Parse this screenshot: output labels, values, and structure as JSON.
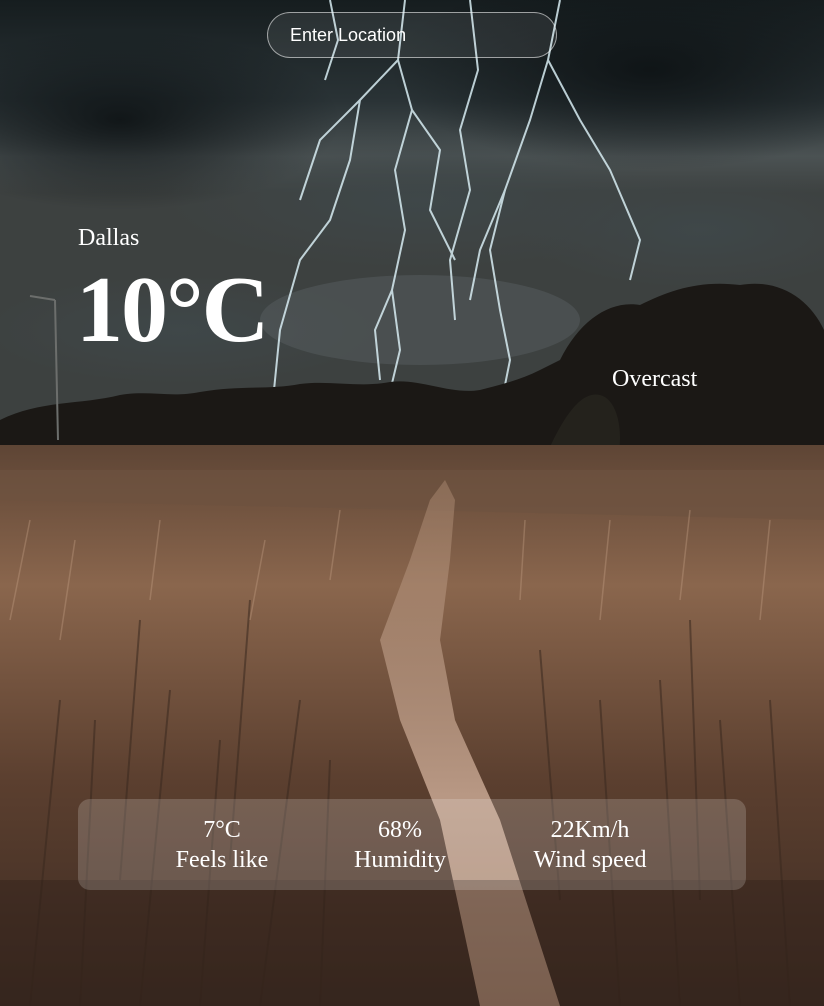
{
  "search": {
    "placeholder": "Enter Location"
  },
  "weather": {
    "location": "Dallas",
    "temperature": "10°C",
    "condition": "Overcast"
  },
  "stats": {
    "feels_like": {
      "value": "7°C",
      "label": "Feels like"
    },
    "humidity": {
      "value": "68%",
      "label": "Humidity"
    },
    "wind_speed": {
      "value": "22Km/h",
      "label": "Wind speed"
    }
  },
  "background": {
    "description_icon": "stormy-field-background",
    "colors": {
      "sky_dark": "#1c2426",
      "sky_mid": "#4a5152",
      "treeline": "#1d1a17",
      "field": "#7a5a43",
      "path": "#b69682",
      "lightning": "#d7ecf2"
    }
  }
}
